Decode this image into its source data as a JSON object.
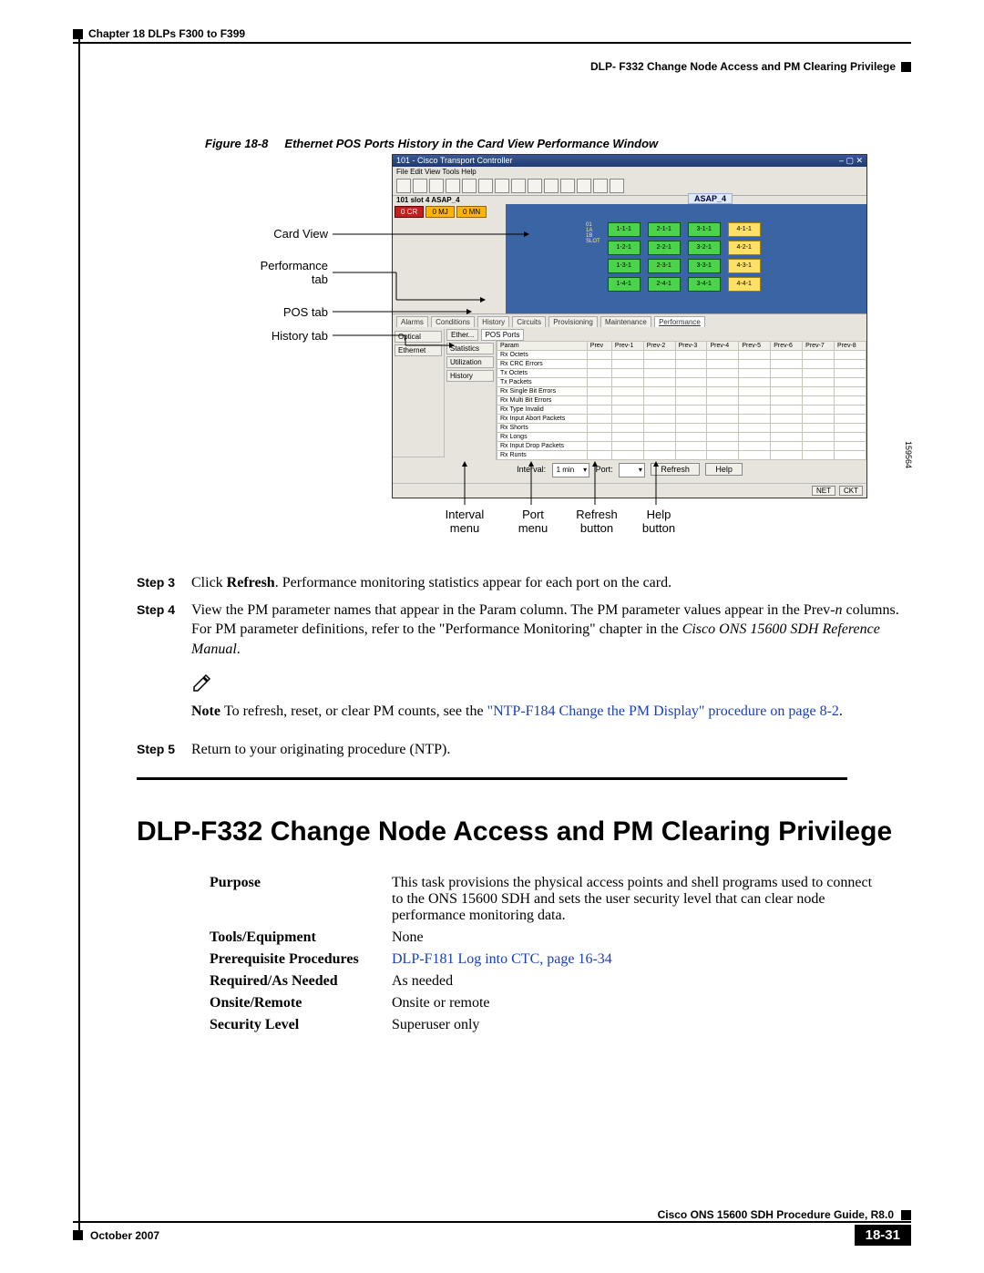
{
  "header": {
    "chapter": "Chapter 18 DLPs F300 to F399",
    "section": "DLP- F332 Change Node Access and PM Clearing Privilege"
  },
  "figure": {
    "label": "Figure 18-8",
    "title": "Ethernet POS Ports History in the Card View Performance Window",
    "image_id": "159564",
    "callouts_left": {
      "card_view": "Card View",
      "performance_tab_l1": "Performance",
      "performance_tab_l2": "tab",
      "pos_tab": "POS tab",
      "history_tab": "History tab"
    },
    "callouts_bottom": {
      "interval_menu_l1": "Interval",
      "interval_menu_l2": "menu",
      "port_menu_l1": "Port",
      "port_menu_l2": "menu",
      "refresh_btn_l1": "Refresh",
      "refresh_btn_l2": "button",
      "help_btn_l1": "Help",
      "help_btn_l2": "button"
    },
    "ctc": {
      "title": "101 - Cisco Transport Controller",
      "menu": "File  Edit  View  Tools  Help",
      "slot": "101 slot 4 ASAP_4",
      "badges": {
        "cr": "0 CR",
        "mj": "0 MJ",
        "mn": "0 MN"
      },
      "asap_label": "ASAP_4",
      "main_tabs": [
        "Alarms",
        "Conditions",
        "History",
        "Circuits",
        "Provisioning",
        "Maintenance",
        "Performance"
      ],
      "side_tabs_outer": [
        "Optical",
        "Ethernet"
      ],
      "pos_tab": "POS Ports",
      "side_tabs_inner": [
        "Statistics",
        "Utilization",
        "History"
      ],
      "grid_headers": [
        "Param",
        "Prev",
        "Prev-1",
        "Prev-2",
        "Prev-3",
        "Prev-4",
        "Prev-5",
        "Prev-6",
        "Prev-7",
        "Prev-8"
      ],
      "grid_params": [
        "Rx Octets",
        "Rx CRC Errors",
        "Tx Octets",
        "Tx Packets",
        "Rx Single Bit Errors",
        "Rx Multi Bit Errors",
        "Rx Type Invalid",
        "Rx Input Abort Packets",
        "Rx Shorts",
        "Rx Longs",
        "Rx Input Drop Packets",
        "Rx Runts"
      ],
      "interval_label": "Interval:",
      "interval_val": "1 min",
      "port_label": "Port:",
      "refresh": "Refresh",
      "help": "Help",
      "status": [
        "NET",
        "CKT"
      ]
    }
  },
  "steps": {
    "s3": {
      "label": "Step 3",
      "t1": "Click ",
      "bold": "Refresh",
      "t2": ". Performance monitoring statistics appear for each port on the card."
    },
    "s4": {
      "label": "Step 4",
      "t1": "View the PM parameter names that appear in the Param column. The PM parameter values appear in the Prev-",
      "i1": "n",
      "t2": " columns. For PM parameter definitions, refer to the \"Performance Monitoring\" chapter in the ",
      "i2": "Cisco ONS 15600 SDH Reference Manual",
      "t3": "."
    },
    "note": {
      "label": "Note",
      "t1": "To refresh, reset, or clear PM counts, see the ",
      "link": "\"NTP-F184 Change the PM Display\" procedure on page 8-2",
      "t2": "."
    },
    "s5": {
      "label": "Step 5",
      "text": "Return to your originating procedure (NTP)."
    }
  },
  "title": "DLP-F332 Change Node Access and PM Clearing Privilege",
  "proc": {
    "purpose_k": "Purpose",
    "purpose_v": "This task provisions the physical access points and shell programs used to connect to the ONS 15600 SDH and sets the user security level that can clear node performance monitoring data.",
    "tools_k": "Tools/Equipment",
    "tools_v": "None",
    "prereq_k": "Prerequisite Procedures",
    "prereq_link": "DLP-F181 Log into CTC, page 16-34",
    "required_k": "Required/As Needed",
    "required_v": "As needed",
    "onsite_k": "Onsite/Remote",
    "onsite_v": "Onsite or remote",
    "security_k": "Security Level",
    "security_v": "Superuser only"
  },
  "footer": {
    "guide": "Cisco ONS 15600 SDH Procedure Guide, R8.0",
    "date": "October 2007",
    "page": "18-31"
  }
}
